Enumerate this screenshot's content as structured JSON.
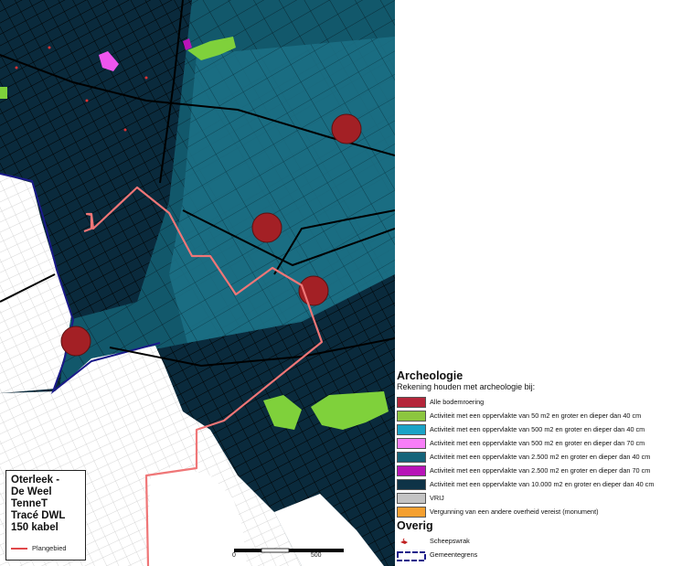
{
  "map": {
    "title_lines": [
      "Oterleek -",
      "De Weel",
      "TenneT",
      "Tracé DWL",
      "150 kabel"
    ],
    "route_legend_label": "Plangebied",
    "scale_labels": [
      "0",
      "500"
    ],
    "colors": {
      "dark_zone": "#0a2a3c",
      "mid_zone": "#12586b",
      "light_zone": "#1b6f84",
      "urban": "#ffffff",
      "route": "#e86a6c",
      "monument": "#a32025",
      "green": "#7fd13b",
      "magenta": "#ee55ee"
    }
  },
  "legend": {
    "title": "Archeologie",
    "subtitle": "Rekening houden met archeologie bij:",
    "items": [
      {
        "label": "Alle bodemroering",
        "color": "#b4263a"
      },
      {
        "label": "Activiteit met een oppervlakte van 50 m2 en groter en dieper dan 40 cm",
        "color": "#8cc63f"
      },
      {
        "label": "Activiteit met een oppervlakte van 500 m2 en groter en dieper dan 40 cm",
        "color": "#1aa3c7"
      },
      {
        "label": "Activiteit met een oppervlakte van 500 m2 en groter en dieper dan 70 cm",
        "color": "#f77ef7"
      },
      {
        "label": "Activiteit met een oppervlakte van 2.500 m2 en groter en dieper dan 40 cm",
        "color": "#14647a"
      },
      {
        "label": "Activiteit met een oppervlakte van 2.500 m2 en groter en dieper dan 70 cm",
        "color": "#b814b8"
      },
      {
        "label": "Activiteit met een oppervlakte van 10.000 m2 en groter en dieper dan 40 cm",
        "color": "#0e3347"
      },
      {
        "label": "VRIJ",
        "color": "#c4c4c4"
      },
      {
        "label": "Vergunning van een andere overheid vereist (monument)",
        "color": "#f5a030"
      }
    ],
    "other_title": "Overig",
    "other_items": [
      {
        "label": "Scheepswrak",
        "icon": "shipwreck-icon"
      },
      {
        "label": "Gemeentegrens",
        "icon": "municipal-boundary-icon"
      }
    ]
  }
}
